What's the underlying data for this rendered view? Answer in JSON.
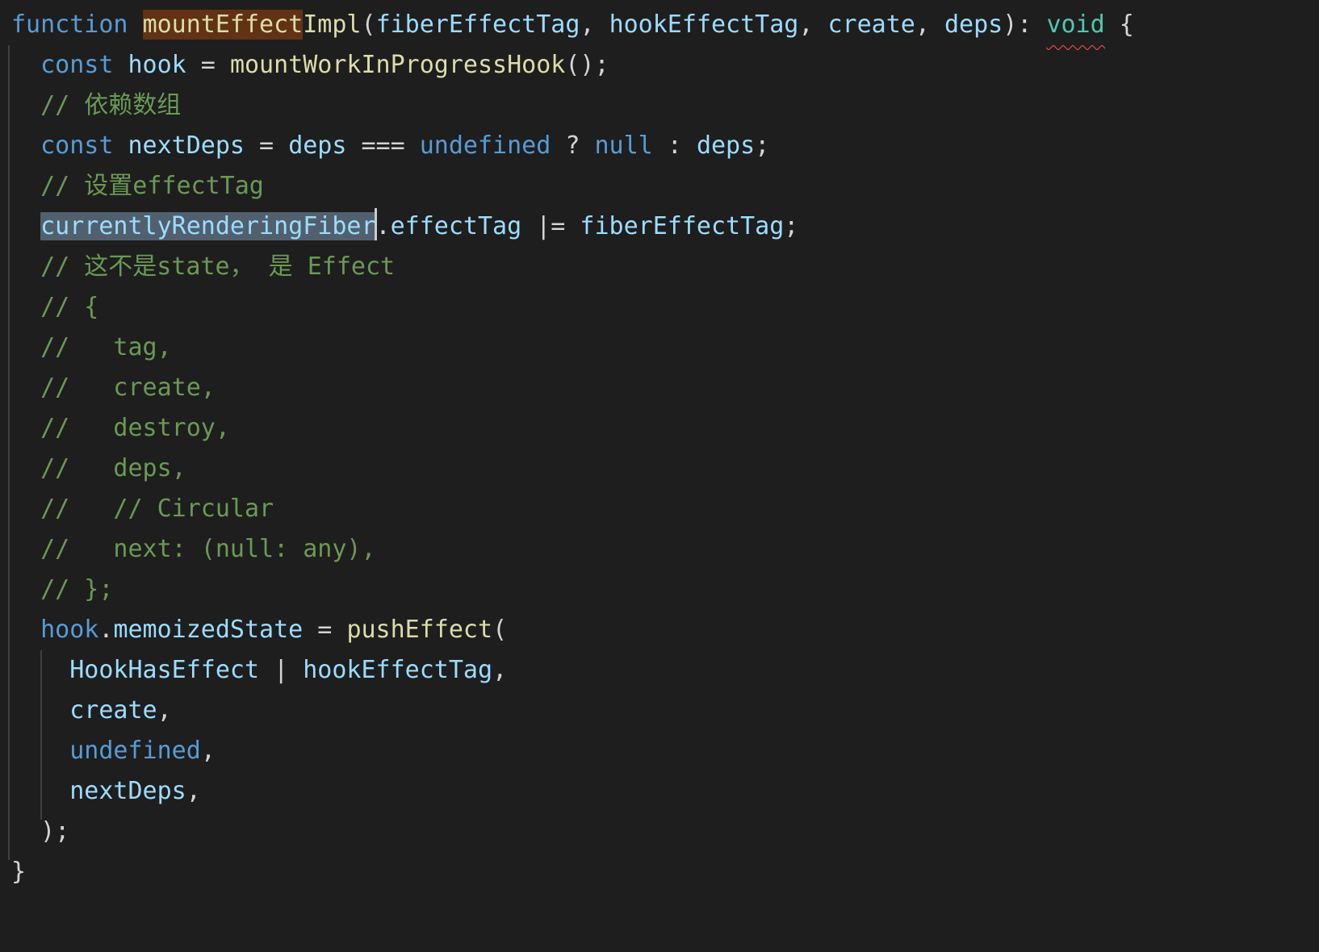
{
  "editor": {
    "theme": "dark-plus",
    "background_color": "#1e1e1e",
    "default_text_color": "#d4d4d4",
    "font_size_px": 30,
    "line_height_px": 50,
    "colors": {
      "keyword": "#569cd6",
      "function": "#dcdcaa",
      "variable": "#9cdcfe",
      "punctuation": "#d4d4d4",
      "type": "#4ec9b0",
      "comment": "#6a9955",
      "occurrence_highlight_bg": "#613214",
      "selection_bg": "#51606f",
      "caret": "#cccccc",
      "error_squiggle": "#f14c4c",
      "indent_guide": "#404040"
    }
  },
  "code": {
    "language": "javascript",
    "lines": [
      {
        "n": 1,
        "text": "function mountEffectImpl(fiberEffectTag, hookEffectTag, create, deps): void {",
        "tokens": [
          {
            "t": "function",
            "c": "keyword"
          },
          {
            "t": " ",
            "c": "punctuation"
          },
          {
            "t": "mountEffect",
            "c": "function",
            "highlight": "occurrence"
          },
          {
            "t": "Impl",
            "c": "function"
          },
          {
            "t": "(",
            "c": "punctuation"
          },
          {
            "t": "fiberEffectTag",
            "c": "variable"
          },
          {
            "t": ", ",
            "c": "punctuation"
          },
          {
            "t": "hookEffectTag",
            "c": "variable"
          },
          {
            "t": ", ",
            "c": "punctuation"
          },
          {
            "t": "create",
            "c": "variable"
          },
          {
            "t": ", ",
            "c": "punctuation"
          },
          {
            "t": "deps",
            "c": "variable"
          },
          {
            "t": "): ",
            "c": "punctuation"
          },
          {
            "t": "void",
            "c": "type",
            "error": true
          },
          {
            "t": " {",
            "c": "punctuation"
          }
        ]
      },
      {
        "n": 2,
        "text": "  const hook = mountWorkInProgressHook();",
        "tokens": [
          {
            "t": "  ",
            "c": "punctuation"
          },
          {
            "t": "const",
            "c": "keyword"
          },
          {
            "t": " ",
            "c": "punctuation"
          },
          {
            "t": "hook",
            "c": "variable"
          },
          {
            "t": " = ",
            "c": "punctuation"
          },
          {
            "t": "mountWorkInProgressHook",
            "c": "function"
          },
          {
            "t": "();",
            "c": "punctuation"
          }
        ]
      },
      {
        "n": 3,
        "text": "  // 依赖数组",
        "tokens": [
          {
            "t": "  ",
            "c": "punctuation"
          },
          {
            "t": "// 依赖数组",
            "c": "comment"
          }
        ]
      },
      {
        "n": 4,
        "text": "  const nextDeps = deps === undefined ? null : deps;",
        "tokens": [
          {
            "t": "  ",
            "c": "punctuation"
          },
          {
            "t": "const",
            "c": "keyword"
          },
          {
            "t": " ",
            "c": "punctuation"
          },
          {
            "t": "nextDeps",
            "c": "variable"
          },
          {
            "t": " = ",
            "c": "punctuation"
          },
          {
            "t": "deps",
            "c": "variable"
          },
          {
            "t": " === ",
            "c": "punctuation"
          },
          {
            "t": "undefined",
            "c": "keyword"
          },
          {
            "t": " ? ",
            "c": "punctuation"
          },
          {
            "t": "null",
            "c": "keyword"
          },
          {
            "t": " : ",
            "c": "punctuation"
          },
          {
            "t": "deps",
            "c": "variable"
          },
          {
            "t": ";",
            "c": "punctuation"
          }
        ]
      },
      {
        "n": 5,
        "text": "  // 设置effectTag",
        "tokens": [
          {
            "t": "  ",
            "c": "punctuation"
          },
          {
            "t": "// 设置effectTag",
            "c": "comment"
          }
        ]
      },
      {
        "n": 6,
        "text": "  currentlyRenderingFiber.effectTag |= fiberEffectTag;",
        "selected_text": "currentlyRenderingFiber",
        "has_caret": true,
        "tokens": [
          {
            "t": "  ",
            "c": "punctuation"
          },
          {
            "t": "currentlyRenderingFiber",
            "c": "variable",
            "highlight": "selection"
          },
          {
            "t": ".",
            "c": "punctuation"
          },
          {
            "t": "effectTag",
            "c": "variable"
          },
          {
            "t": " |= ",
            "c": "punctuation"
          },
          {
            "t": "fiberEffectTag",
            "c": "variable"
          },
          {
            "t": ";",
            "c": "punctuation"
          }
        ]
      },
      {
        "n": 7,
        "text": "  // 这不是state， 是 Effect",
        "tokens": [
          {
            "t": "  ",
            "c": "punctuation"
          },
          {
            "t": "// 这不是state， 是 Effect",
            "c": "comment"
          }
        ]
      },
      {
        "n": 8,
        "text": "  // {",
        "tokens": [
          {
            "t": "  ",
            "c": "punctuation"
          },
          {
            "t": "// {",
            "c": "comment"
          }
        ]
      },
      {
        "n": 9,
        "text": "  //   tag,",
        "tokens": [
          {
            "t": "  ",
            "c": "punctuation"
          },
          {
            "t": "//   tag,",
            "c": "comment"
          }
        ]
      },
      {
        "n": 10,
        "text": "  //   create,",
        "tokens": [
          {
            "t": "  ",
            "c": "punctuation"
          },
          {
            "t": "//   create,",
            "c": "comment"
          }
        ]
      },
      {
        "n": 11,
        "text": "  //   destroy,",
        "tokens": [
          {
            "t": "  ",
            "c": "punctuation"
          },
          {
            "t": "//   destroy,",
            "c": "comment"
          }
        ]
      },
      {
        "n": 12,
        "text": "  //   deps,",
        "tokens": [
          {
            "t": "  ",
            "c": "punctuation"
          },
          {
            "t": "//   deps,",
            "c": "comment"
          }
        ]
      },
      {
        "n": 13,
        "text": "  //   // Circular",
        "tokens": [
          {
            "t": "  ",
            "c": "punctuation"
          },
          {
            "t": "//   // Circular",
            "c": "comment"
          }
        ]
      },
      {
        "n": 14,
        "text": "  //   next: (null: any),",
        "tokens": [
          {
            "t": "  ",
            "c": "punctuation"
          },
          {
            "t": "//   next: (null: any),",
            "c": "comment"
          }
        ]
      },
      {
        "n": 15,
        "text": "  // };",
        "tokens": [
          {
            "t": "  ",
            "c": "punctuation"
          },
          {
            "t": "// };",
            "c": "comment"
          }
        ]
      },
      {
        "n": 16,
        "text": "  hook.memoizedState = pushEffect(",
        "tokens": [
          {
            "t": "  ",
            "c": "punctuation"
          },
          {
            "t": "hook",
            "c": "keyword"
          },
          {
            "t": ".",
            "c": "punctuation"
          },
          {
            "t": "memoizedState",
            "c": "variable"
          },
          {
            "t": " = ",
            "c": "punctuation"
          },
          {
            "t": "pushEffect",
            "c": "function"
          },
          {
            "t": "(",
            "c": "punctuation"
          }
        ]
      },
      {
        "n": 17,
        "text": "    HookHasEffect | hookEffectTag,",
        "tokens": [
          {
            "t": "    ",
            "c": "punctuation"
          },
          {
            "t": "HookHasEffect",
            "c": "variable"
          },
          {
            "t": " | ",
            "c": "punctuation"
          },
          {
            "t": "hookEffectTag",
            "c": "variable"
          },
          {
            "t": ",",
            "c": "punctuation"
          }
        ]
      },
      {
        "n": 18,
        "text": "    create,",
        "tokens": [
          {
            "t": "    ",
            "c": "punctuation"
          },
          {
            "t": "create",
            "c": "variable"
          },
          {
            "t": ",",
            "c": "punctuation"
          }
        ]
      },
      {
        "n": 19,
        "text": "    undefined,",
        "tokens": [
          {
            "t": "    ",
            "c": "punctuation"
          },
          {
            "t": "undefined",
            "c": "keyword"
          },
          {
            "t": ",",
            "c": "punctuation"
          }
        ]
      },
      {
        "n": 20,
        "text": "    nextDeps,",
        "tokens": [
          {
            "t": "    ",
            "c": "punctuation"
          },
          {
            "t": "nextDeps",
            "c": "variable"
          },
          {
            "t": ",",
            "c": "punctuation"
          }
        ]
      },
      {
        "n": 21,
        "text": "  );",
        "tokens": [
          {
            "t": "  );",
            "c": "punctuation"
          }
        ]
      },
      {
        "n": 22,
        "text": "}",
        "tokens": [
          {
            "t": "}",
            "c": "punctuation"
          }
        ]
      }
    ]
  }
}
